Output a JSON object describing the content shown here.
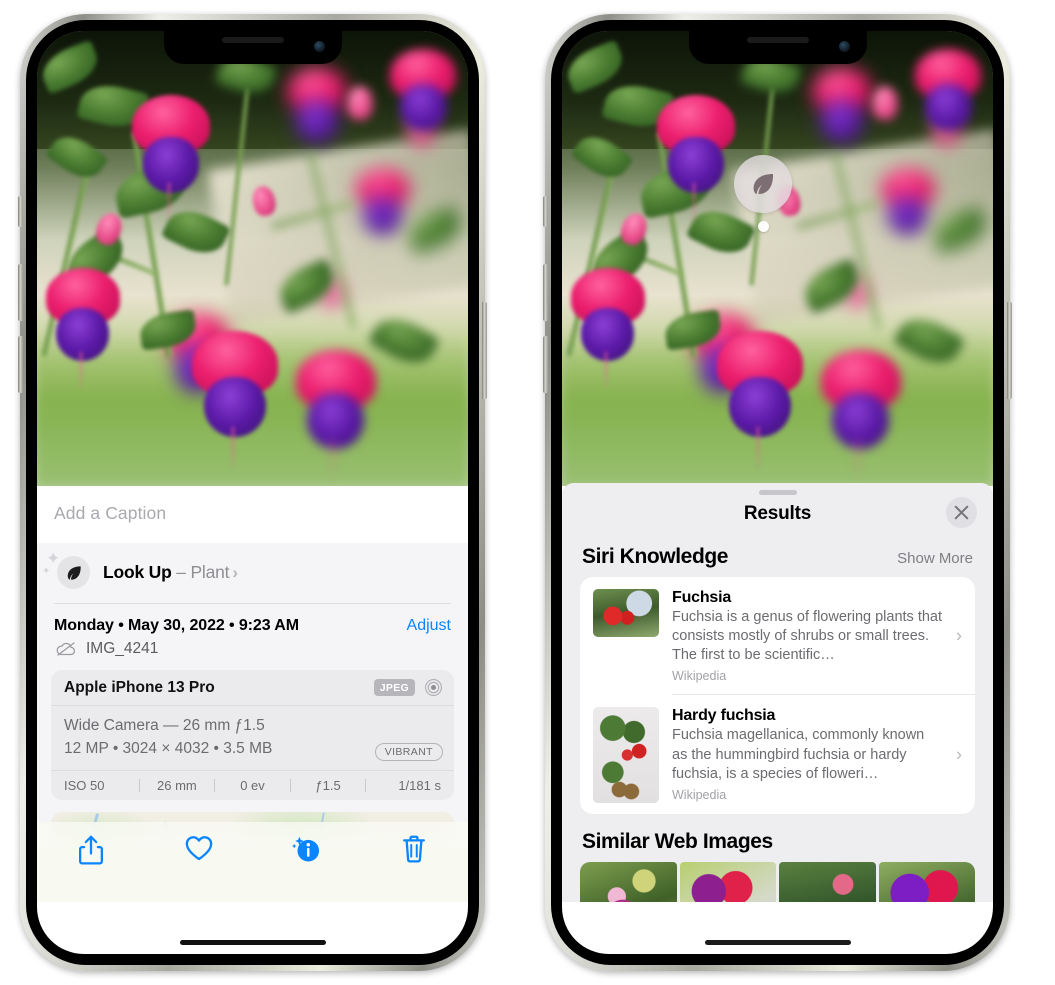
{
  "left_phone": {
    "name": "photos-detail-phone",
    "caption": {
      "placeholder": "Add a Caption",
      "value": ""
    },
    "look_up": {
      "label": "Look Up",
      "dash": " – ",
      "subject": "Plant",
      "chevron": "›",
      "icon": "leaf-icon"
    },
    "meta": {
      "date": "Monday • May 30, 2022 • 9:23 AM",
      "adjust_label": "Adjust",
      "filename": "IMG_4241",
      "cloud_icon": "cloud-slash-icon"
    },
    "exif": {
      "device": "Apple iPhone 13 Pro",
      "format_badge": "JPEG",
      "camera_icon": "aperture-icon",
      "lens_line": "Wide Camera — 26 mm ƒ1.5",
      "size_line": "12 MP • 3024 × 4032 • 3.5 MB",
      "style_badge": "VIBRANT",
      "stats": [
        "ISO 50",
        "26 mm",
        "0 ev",
        "ƒ1.5",
        "1/181 s"
      ]
    },
    "map": {
      "name": "location-map",
      "pin_label": ""
    },
    "toolbar": [
      {
        "name": "share-button",
        "icon": "share-icon",
        "label": "Share"
      },
      {
        "name": "favorite-button",
        "icon": "heart-icon",
        "label": "Favorite"
      },
      {
        "name": "info-button",
        "icon": "info-sparkle-icon",
        "label": "Info"
      },
      {
        "name": "delete-button",
        "icon": "trash-icon",
        "label": "Delete"
      }
    ]
  },
  "right_phone": {
    "name": "visual-lookup-results-phone",
    "lookup_badge": {
      "icon": "leaf-icon",
      "name": "visual-lookup-badge"
    },
    "sheet": {
      "title": "Results",
      "close_icon": "close-icon",
      "sections": [
        {
          "title": "Siri Knowledge",
          "action_label": "Show More",
          "items": [
            {
              "name": "Fuchsia",
              "description": "Fuchsia is a genus of flowering plants that consists mostly of shrubs or small trees. The first to be scientific…",
              "source": "Wikipedia",
              "chevron": "›",
              "thumb": "fuchsia-red-flowers-thumb"
            },
            {
              "name": "Hardy fuchsia",
              "description": "Fuchsia magellanica, commonly known as the hummingbird fuchsia or hardy fuchsia, is a species of floweri…",
              "source": "Wikipedia",
              "chevron": "›",
              "thumb": "hardy-fuchsia-specimen-thumb"
            }
          ]
        },
        {
          "title": "Similar Web Images",
          "items": [
            {
              "name": "similar-image-1"
            },
            {
              "name": "similar-image-2"
            },
            {
              "name": "similar-image-3"
            },
            {
              "name": "similar-image-4"
            }
          ]
        }
      ]
    }
  },
  "colors": {
    "accent_blue": "#0a84ff",
    "sheet_bg": "#f5f5f7",
    "results_bg": "#eeeef1",
    "card_white": "#ffffff",
    "secondary_text": "#6c6c70",
    "tertiary_text": "#a9a9ae"
  }
}
